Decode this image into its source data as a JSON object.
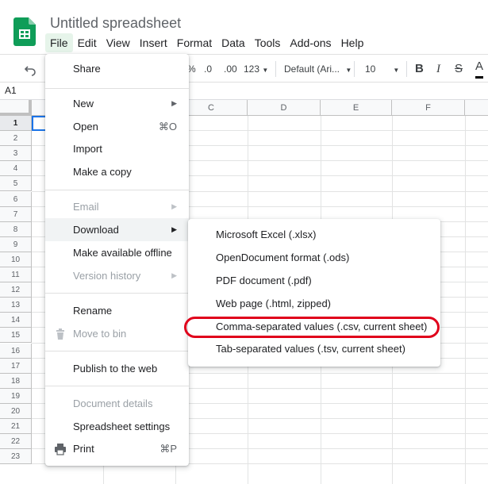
{
  "document": {
    "title": "Untitled spreadsheet",
    "logo": "sheets-logo"
  },
  "menubar": [
    "File",
    "Edit",
    "View",
    "Insert",
    "Format",
    "Data",
    "Tools",
    "Add-ons",
    "Help"
  ],
  "toolbar": {
    "undo": "undo-icon",
    "percent": "%",
    "decrease_decimal": ".0",
    "increase_decimal": ".00",
    "number_format": "123",
    "font_family": "Default (Ari...",
    "font_size": "10",
    "bold": "B",
    "italic": "I",
    "strikethrough": "S",
    "text_color": "A"
  },
  "name_box": "A1",
  "grid": {
    "columns": [
      "C",
      "D",
      "E",
      "F"
    ],
    "rows": [
      "1",
      "2",
      "3",
      "4",
      "5",
      "6",
      "7",
      "8",
      "9",
      "10",
      "11",
      "12",
      "13",
      "14",
      "15",
      "16",
      "17",
      "18",
      "19",
      "20",
      "21",
      "22",
      "23"
    ],
    "selected_cell": "A1"
  },
  "file_menu": {
    "share": "Share",
    "new": "New",
    "open": "Open",
    "open_shortcut": "⌘O",
    "import": "Import",
    "make_copy": "Make a copy",
    "email": "Email",
    "download": "Download",
    "offline": "Make available offline",
    "version_history": "Version history",
    "rename": "Rename",
    "move_to_bin": "Move to bin",
    "publish": "Publish to the web",
    "document_details": "Document details",
    "spreadsheet_settings": "Spreadsheet settings",
    "print": "Print",
    "print_shortcut": "⌘P"
  },
  "download_menu": [
    "Microsoft Excel (.xlsx)",
    "OpenDocument format (.ods)",
    "PDF document (.pdf)",
    "Web page (.html, zipped)",
    "Comma-separated values (.csv, current sheet)",
    "Tab-separated values (.tsv, current sheet)"
  ],
  "highlighted_item": "Comma-separated values (.csv, current sheet)",
  "colors": {
    "accent": "#1a73e8",
    "highlight_ring": "#e0001b",
    "sheets_green": "#0f9d58"
  }
}
